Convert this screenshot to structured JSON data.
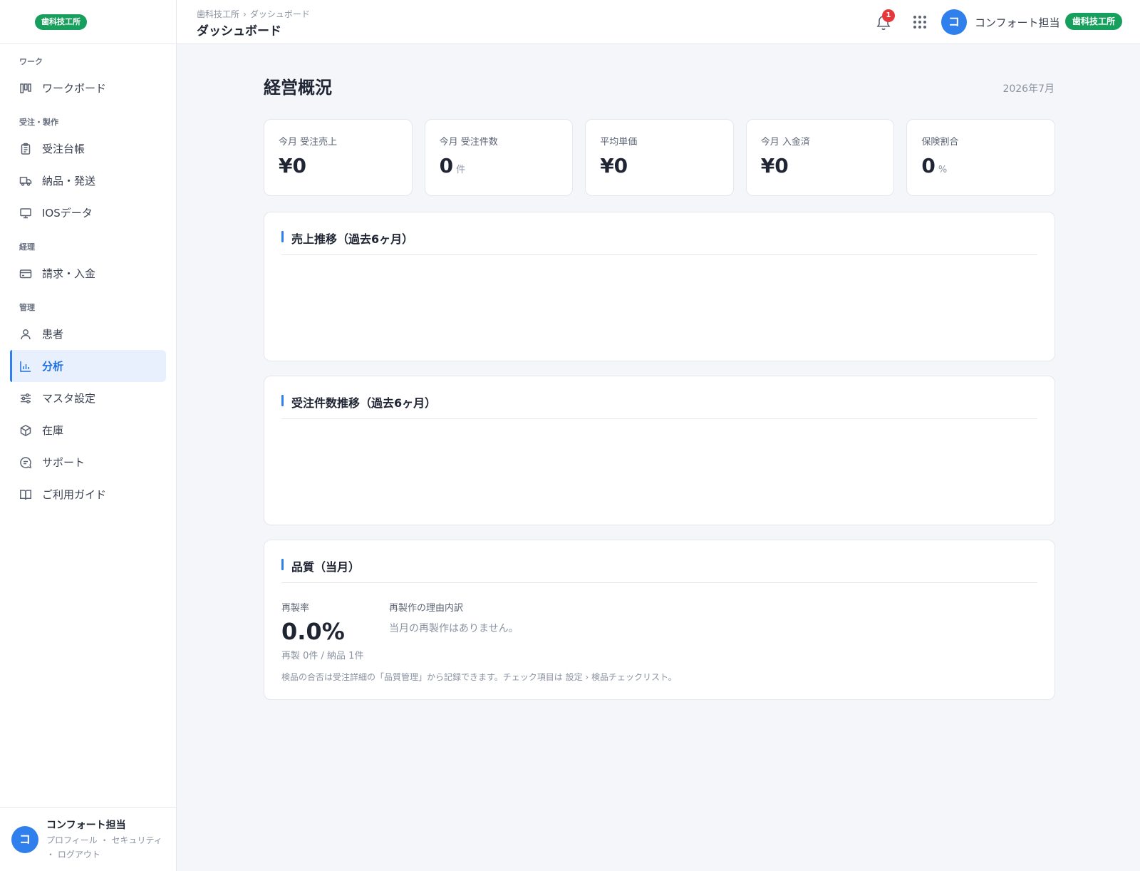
{
  "brand": {
    "badge": "歯科技工所"
  },
  "sidebar": {
    "sections": [
      {
        "title": "ワーク",
        "items": [
          {
            "label": "ワークボード",
            "icon": "kanban-icon"
          }
        ]
      },
      {
        "title": "受注・製作",
        "items": [
          {
            "label": "受注台帳",
            "icon": "clipboard-icon"
          },
          {
            "label": "納品・発送",
            "icon": "truck-icon"
          },
          {
            "label": "IOSデータ",
            "icon": "monitor-icon"
          }
        ]
      },
      {
        "title": "経理",
        "items": [
          {
            "label": "請求・入金",
            "icon": "credit-card-icon"
          }
        ]
      },
      {
        "title": "管理",
        "items": [
          {
            "label": "患者",
            "icon": "user-icon"
          },
          {
            "label": "分析",
            "icon": "bar-chart-icon",
            "active": true
          },
          {
            "label": "マスタ設定",
            "icon": "sliders-icon"
          },
          {
            "label": "在庫",
            "icon": "box-icon"
          },
          {
            "label": "サポート",
            "icon": "chat-icon"
          },
          {
            "label": "ご利用ガイド",
            "icon": "book-icon"
          }
        ]
      }
    ],
    "user": {
      "avatar": "コ",
      "name": "コンフォート担当",
      "links": [
        "プロフィール",
        "・",
        "セキュリティ",
        "・",
        "ログアウト"
      ]
    }
  },
  "topbar": {
    "breadcrumb": [
      "歯科技工所",
      "ダッシュボード"
    ],
    "breadcrumb_sep": "›",
    "title": "ダッシュボード",
    "notifications": "1",
    "avatar": "コ",
    "user": "コンフォート担当",
    "org_badge": "歯科技工所"
  },
  "main": {
    "title": "経営概況",
    "month": "2026年7月",
    "kpis": [
      {
        "label": "今月 受注売上",
        "value": "¥0",
        "unit": ""
      },
      {
        "label": "今月 受注件数",
        "value": "0",
        "unit": "件"
      },
      {
        "label": "平均単価",
        "value": "¥0",
        "unit": ""
      },
      {
        "label": "今月 入金済",
        "value": "¥0",
        "unit": ""
      },
      {
        "label": "保険割合",
        "value": "0",
        "unit": "%"
      }
    ],
    "sales_trend": {
      "title": "売上推移（過去6ヶ月）"
    },
    "orders_trend": {
      "title": "受注件数推移（過去6ヶ月）"
    },
    "quality": {
      "title": "品質（当月）",
      "remake_label": "再製率",
      "remake_rate": "0.0%",
      "remake_detail": "再製 0件 / 納品 1件",
      "reasons_label": "再製作の理由内訳",
      "reasons_empty": "当月の再製作はありません。",
      "note": "検品の合否は受注詳細の「品質管理」から記録できます。チェック項目は 設定 › 検品チェックリスト。"
    }
  },
  "colors": {
    "accent": "#2f80ed",
    "brand_green": "#17a05d",
    "alert": "#e5383b"
  }
}
